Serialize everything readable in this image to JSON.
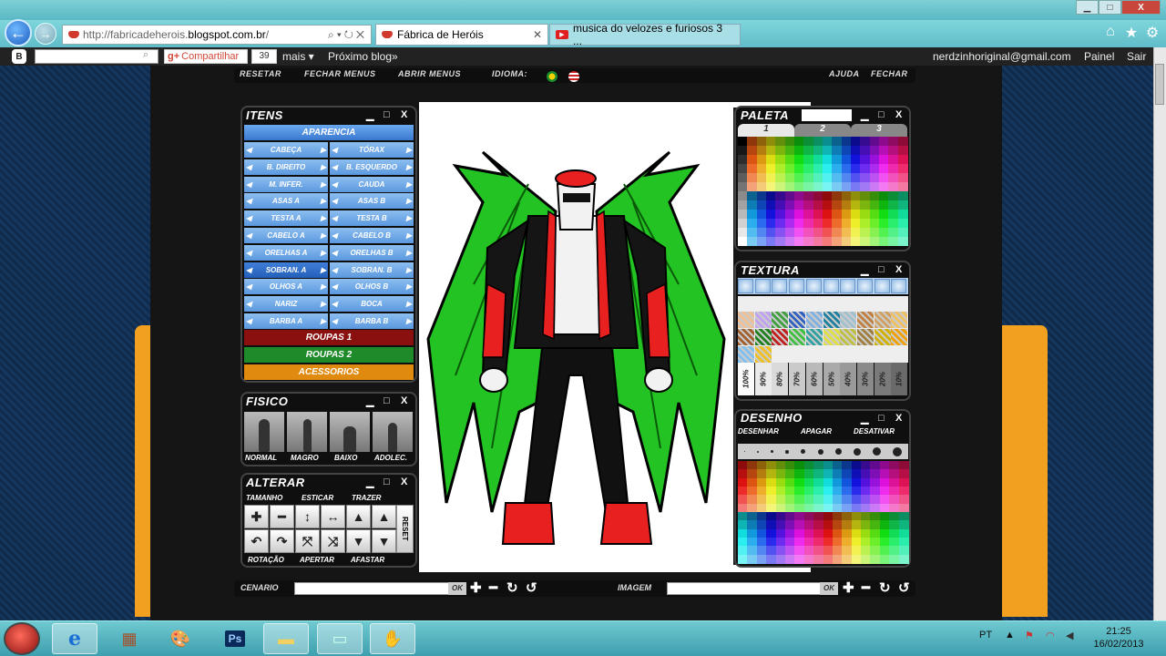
{
  "browser": {
    "address": {
      "prefix": "http://fabricadeherois.",
      "domain": "blogspot.com.br",
      "suffix": "/"
    },
    "tabs": [
      {
        "title": "Fábrica de Heróis",
        "active": true
      },
      {
        "title": "musica do velozes e furiosos 3 ...",
        "active": false
      }
    ],
    "window_controls": {
      "minimize": "▁",
      "maximize": "□",
      "close": "X"
    }
  },
  "bloggerbar": {
    "share_label": "Compartilhar",
    "share_count": "39",
    "more_label": "mais ▾",
    "next_blog": "Próximo blog»",
    "email": "nerdzinhoriginal@gmail.com",
    "panel": "Painel",
    "logout": "Sair"
  },
  "menu": {
    "reset": "RESETAR",
    "close_menus": "FECHAR MENUS",
    "open_menus": "ABRIR MENUS",
    "language": "IDIOMA:",
    "help": "AJUDA",
    "close": "FECHAR"
  },
  "panel_controls": {
    "min": "▁",
    "max": "□",
    "close": "X"
  },
  "itens": {
    "title": "ITENS",
    "aparencia": "APARENCIA",
    "rows": [
      [
        "CABEÇA",
        "TÓRAX"
      ],
      [
        "B. DIREITO",
        "B. ESQUERDO"
      ],
      [
        "M. INFER.",
        "CAUDA"
      ],
      [
        "ASAS A",
        "ASAS B"
      ],
      [
        "TESTA A",
        "TESTA B"
      ],
      [
        "CABELO A",
        "CABELO B"
      ],
      [
        "ORELHAS A",
        "ORELHAS B"
      ],
      [
        "SOBRAN. A",
        "SOBRAN. B"
      ],
      [
        "OLHOS A",
        "OLHOS B"
      ],
      [
        "NARIZ",
        "BOCA"
      ],
      [
        "BARBA A",
        "BARBA B"
      ]
    ],
    "roupas1": "ROUPAS 1",
    "roupas2": "ROUPAS 2",
    "acessorios": "ACESSORIOS"
  },
  "fisico": {
    "title": "FISICO",
    "types": [
      "NORMAL",
      "MAGRO",
      "BAIXO",
      "ADOLEC."
    ]
  },
  "alterar": {
    "title": "ALTERAR",
    "top_labels": [
      "TAMANHO",
      "ESTICAR",
      "TRAZER"
    ],
    "bottom_labels": [
      "ROTAÇÃO",
      "APERTAR",
      "AFASTAR"
    ],
    "reset": "RESET",
    "buttons_row1": [
      "✚",
      "━",
      "↕",
      "↔",
      "▲",
      "▲"
    ],
    "buttons_row2": [
      "↶",
      "↷",
      "⤧",
      "⤨",
      "▼",
      "▼"
    ]
  },
  "paleta": {
    "title": "PALETA",
    "tabs": [
      "1",
      "2",
      "3"
    ]
  },
  "textura": {
    "title": "TEXTURA",
    "opacities": [
      "100%",
      "90%",
      "80%",
      "70%",
      "60%",
      "50%",
      "40%",
      "30%",
      "20%",
      "10%"
    ]
  },
  "desenho": {
    "title": "DESENHO",
    "actions": [
      "DESENHAR",
      "APAGAR",
      "DESATIVAR"
    ]
  },
  "bottombar": {
    "cenario": "CENARIO",
    "imagem": "IMAGEM",
    "ok": "OK",
    "plus": "✚",
    "minus": "━",
    "rotate_right": "↻",
    "rotate_left": "↺"
  },
  "taskbar": {
    "language": "PT",
    "time": "21:25",
    "date": "16/02/2013"
  },
  "colors": {
    "accent_blue": "#5b98de",
    "roupas1": "#8a1010",
    "roupas2": "#1f8a2a",
    "acessorios": "#e08a10"
  }
}
